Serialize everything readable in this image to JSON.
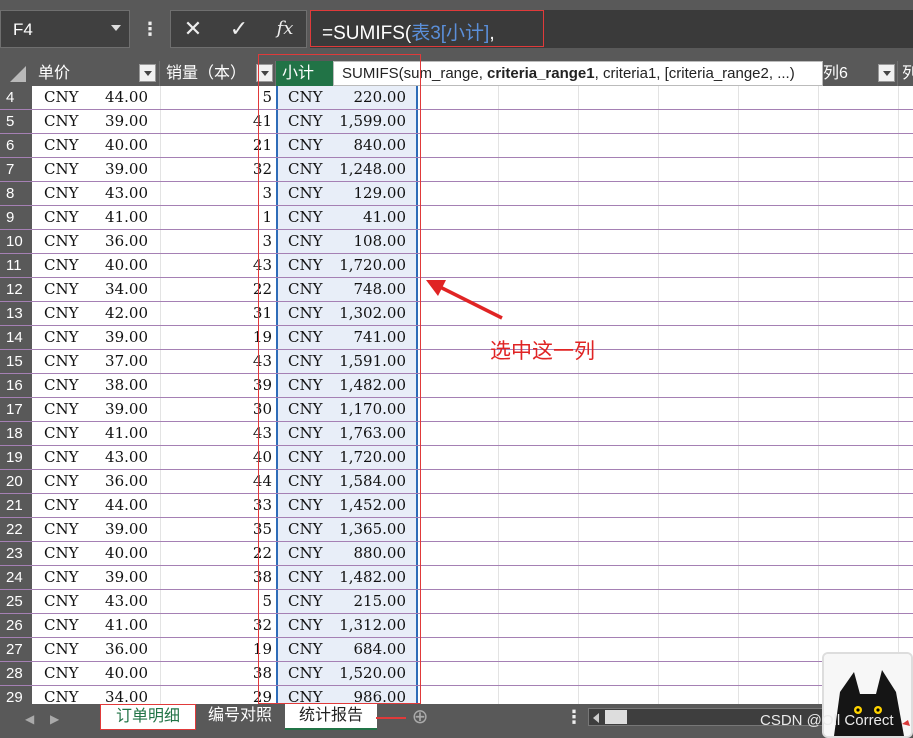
{
  "name_box": {
    "value": "F4"
  },
  "formula_bar": {
    "prefix": "=SUMIFS(",
    "table_ref": "表3[小计]",
    "suffix": ",",
    "cancel_symbol": "✕",
    "enter_symbol": "✓",
    "fx_symbol": "fx"
  },
  "tooltip": {
    "func": "SUMIFS(sum_range, ",
    "current_arg": "criteria_range1",
    "rest": ", criteria1, [criteria_range2, ...)"
  },
  "columns": {
    "unit_price": "单价",
    "quantity": "销量（本）",
    "subtotal": "小计",
    "col6": "列6",
    "next": "列"
  },
  "rows": [
    {
      "n": "4",
      "cur": "CNY",
      "price": "44.00",
      "qty": "5",
      "sub_cur": "CNY",
      "sub": "220.00"
    },
    {
      "n": "5",
      "cur": "CNY",
      "price": "39.00",
      "qty": "41",
      "sub_cur": "CNY",
      "sub": "1,599.00"
    },
    {
      "n": "6",
      "cur": "CNY",
      "price": "40.00",
      "qty": "21",
      "sub_cur": "CNY",
      "sub": "840.00"
    },
    {
      "n": "7",
      "cur": "CNY",
      "price": "39.00",
      "qty": "32",
      "sub_cur": "CNY",
      "sub": "1,248.00"
    },
    {
      "n": "8",
      "cur": "CNY",
      "price": "43.00",
      "qty": "3",
      "sub_cur": "CNY",
      "sub": "129.00"
    },
    {
      "n": "9",
      "cur": "CNY",
      "price": "41.00",
      "qty": "1",
      "sub_cur": "CNY",
      "sub": "41.00"
    },
    {
      "n": "10",
      "cur": "CNY",
      "price": "36.00",
      "qty": "3",
      "sub_cur": "CNY",
      "sub": "108.00"
    },
    {
      "n": "11",
      "cur": "CNY",
      "price": "40.00",
      "qty": "43",
      "sub_cur": "CNY",
      "sub": "1,720.00"
    },
    {
      "n": "12",
      "cur": "CNY",
      "price": "34.00",
      "qty": "22",
      "sub_cur": "CNY",
      "sub": "748.00"
    },
    {
      "n": "13",
      "cur": "CNY",
      "price": "42.00",
      "qty": "31",
      "sub_cur": "CNY",
      "sub": "1,302.00"
    },
    {
      "n": "14",
      "cur": "CNY",
      "price": "39.00",
      "qty": "19",
      "sub_cur": "CNY",
      "sub": "741.00"
    },
    {
      "n": "15",
      "cur": "CNY",
      "price": "37.00",
      "qty": "43",
      "sub_cur": "CNY",
      "sub": "1,591.00"
    },
    {
      "n": "16",
      "cur": "CNY",
      "price": "38.00",
      "qty": "39",
      "sub_cur": "CNY",
      "sub": "1,482.00"
    },
    {
      "n": "17",
      "cur": "CNY",
      "price": "39.00",
      "qty": "30",
      "sub_cur": "CNY",
      "sub": "1,170.00"
    },
    {
      "n": "18",
      "cur": "CNY",
      "price": "41.00",
      "qty": "43",
      "sub_cur": "CNY",
      "sub": "1,763.00"
    },
    {
      "n": "19",
      "cur": "CNY",
      "price": "43.00",
      "qty": "40",
      "sub_cur": "CNY",
      "sub": "1,720.00"
    },
    {
      "n": "20",
      "cur": "CNY",
      "price": "36.00",
      "qty": "44",
      "sub_cur": "CNY",
      "sub": "1,584.00"
    },
    {
      "n": "21",
      "cur": "CNY",
      "price": "44.00",
      "qty": "33",
      "sub_cur": "CNY",
      "sub": "1,452.00"
    },
    {
      "n": "22",
      "cur": "CNY",
      "price": "39.00",
      "qty": "35",
      "sub_cur": "CNY",
      "sub": "1,365.00"
    },
    {
      "n": "23",
      "cur": "CNY",
      "price": "40.00",
      "qty": "22",
      "sub_cur": "CNY",
      "sub": "880.00"
    },
    {
      "n": "24",
      "cur": "CNY",
      "price": "39.00",
      "qty": "38",
      "sub_cur": "CNY",
      "sub": "1,482.00"
    },
    {
      "n": "25",
      "cur": "CNY",
      "price": "43.00",
      "qty": "5",
      "sub_cur": "CNY",
      "sub": "215.00"
    },
    {
      "n": "26",
      "cur": "CNY",
      "price": "41.00",
      "qty": "32",
      "sub_cur": "CNY",
      "sub": "1,312.00"
    },
    {
      "n": "27",
      "cur": "CNY",
      "price": "36.00",
      "qty": "19",
      "sub_cur": "CNY",
      "sub": "684.00"
    },
    {
      "n": "28",
      "cur": "CNY",
      "price": "40.00",
      "qty": "38",
      "sub_cur": "CNY",
      "sub": "1,520.00"
    },
    {
      "n": "29",
      "cur": "CNY",
      "price": "34.00",
      "qty": "29",
      "sub_cur": "CNY",
      "sub": "986.00"
    }
  ],
  "annotation": {
    "text": "选中这一列"
  },
  "sheet_tabs": [
    "订单明细",
    "编号对照",
    "统计报告"
  ],
  "add_sheet": "⊕",
  "watermark": "CSDN @Oll Correct",
  "colors": {
    "excel_green": "#217346",
    "annotation_red": "#e02424",
    "selection_blue": "#2e6cb8"
  }
}
